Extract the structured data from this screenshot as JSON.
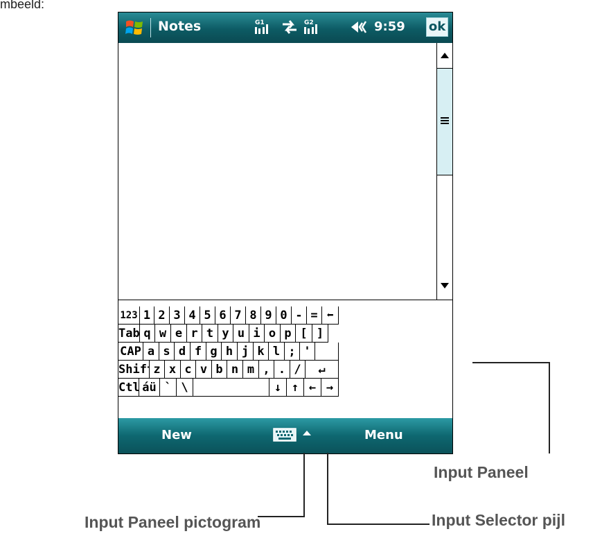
{
  "top_text": "mbeeld:",
  "titlebar": {
    "app_title": "Notes",
    "time": "9:59",
    "ok_label": "ok",
    "signal_1_label": "G1",
    "signal_2_label": "G2"
  },
  "keyboard": {
    "rows": [
      [
        "123",
        "1",
        "2",
        "3",
        "4",
        "5",
        "6",
        "7",
        "8",
        "9",
        "0",
        "-",
        "=",
        "⬅"
      ],
      [
        "Tab",
        "q",
        "w",
        "e",
        "r",
        "t",
        "y",
        "u",
        "i",
        "o",
        "p",
        "[",
        "]"
      ],
      [
        "CAP",
        "a",
        "s",
        "d",
        "f",
        "g",
        "h",
        "j",
        "k",
        "l",
        ";",
        "'",
        ""
      ],
      [
        "Shift",
        "z",
        "x",
        "c",
        "v",
        "b",
        "n",
        "m",
        ",",
        ".",
        "/",
        "↵"
      ],
      [
        "Ctl",
        "áü",
        "`",
        "\\",
        "",
        "↓",
        "↑",
        "←",
        "→"
      ]
    ]
  },
  "menubar": {
    "left_label": "New",
    "right_label": "Menu"
  },
  "callouts": {
    "input_panel": "Input Paneel",
    "input_panel_icon": "Input Paneel pictogram",
    "input_selector_arrow": "Input Selector pijl"
  },
  "colors": {
    "titlebar": "#0d5b64",
    "menubar": "#0e6770",
    "scroll_thumb": "#d7eff3",
    "callout_text": "#555555"
  },
  "icons": [
    "windows-start-icon",
    "signal-icon",
    "data-sync-icon",
    "volume-icon",
    "keyboard-icon",
    "input-selector-arrow-icon"
  ]
}
